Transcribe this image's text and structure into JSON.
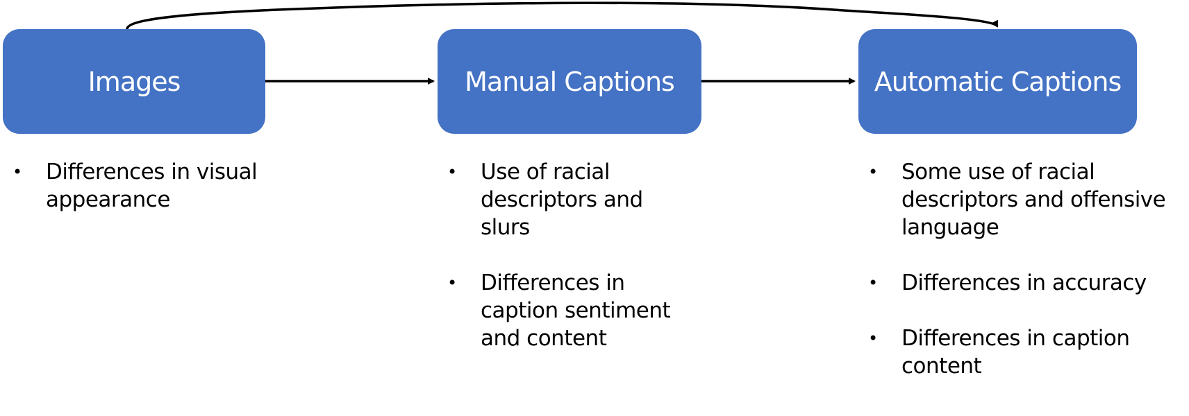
{
  "nodes": {
    "images": {
      "label": "Images",
      "bullets": [
        "Differences in visual appearance"
      ]
    },
    "manual": {
      "label": "Manual Captions",
      "bullets": [
        "Use of racial descriptors and slurs",
        "Differences in caption sentiment and content"
      ]
    },
    "automatic": {
      "label": "Automatic Captions",
      "bullets": [
        "Some use of racial descriptors and offensive language",
        "Differences in accuracy",
        "Differences in caption content"
      ]
    }
  },
  "edges": [
    {
      "from": "Images",
      "to": "Manual Captions"
    },
    {
      "from": "Manual Captions",
      "to": "Automatic Captions"
    },
    {
      "from": "Images",
      "to": "Automatic Captions"
    }
  ],
  "colors": {
    "box_fill": "#4472c4",
    "box_text": "#ffffff",
    "arrow": "#000000"
  },
  "bullet_glyph": "•"
}
